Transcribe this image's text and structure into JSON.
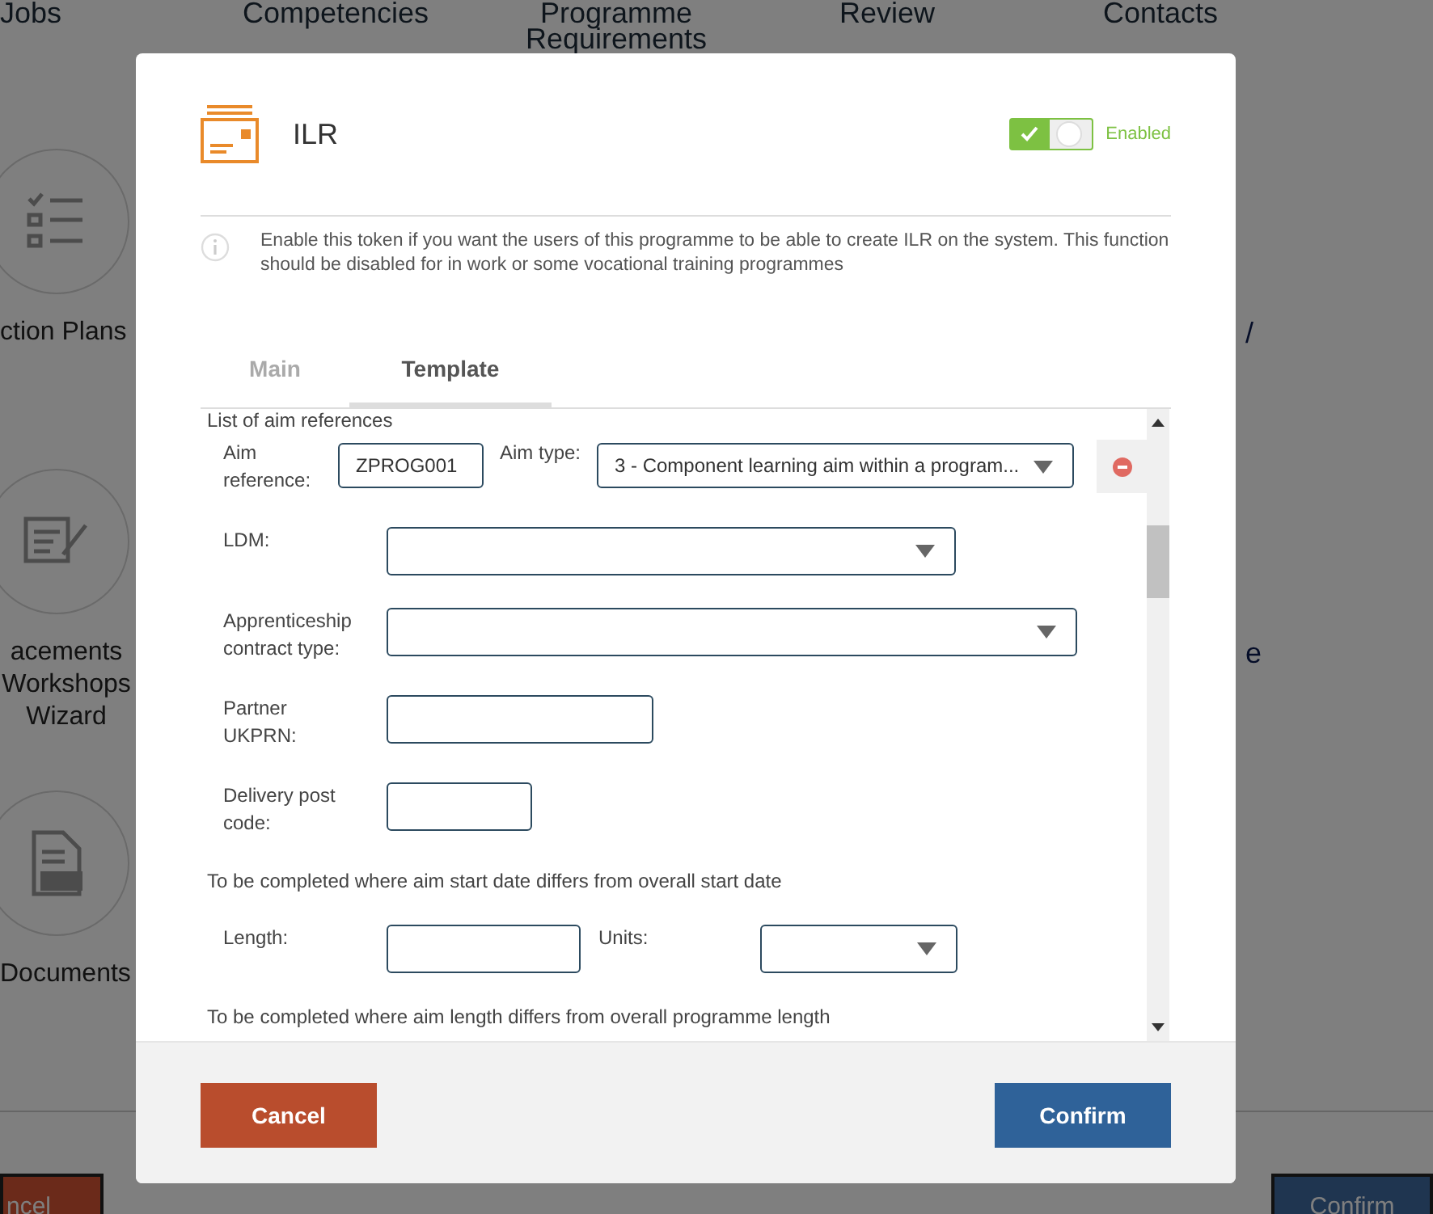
{
  "background": {
    "nav": [
      "Jobs",
      "Competencies",
      "Programme Requirements",
      "Review",
      "Contacts"
    ],
    "side_items": [
      {
        "label": "ction Plans",
        "kind": "list",
        "fragment": "/"
      },
      {
        "label": "acements Workshops Wizard",
        "kind": "edit",
        "fragment": "e"
      },
      {
        "label": "Documents",
        "kind": "pdf"
      }
    ],
    "buttons": [
      {
        "label": "ncel",
        "kind": "cancel"
      },
      {
        "label": "Confirm",
        "kind": "confirm"
      }
    ]
  },
  "dialog": {
    "title": "ILR",
    "toggle": {
      "on": true,
      "label": "Enabled"
    },
    "info": "Enable this token if you want the users of this programme to be able to create ILR on the system. This function should be disabled for in work or some vocational training programmes",
    "tabs": [
      {
        "label": "Main",
        "selected": false
      },
      {
        "label": "Template",
        "selected": true
      }
    ],
    "section_title": "List of aim references",
    "aim": {
      "reference_label": "Aim reference:",
      "reference_value": "ZPROG001",
      "type_label": "Aim type:",
      "type_value": "3 - Component learning aim within a program..."
    },
    "fields": [
      {
        "label": "LDM:",
        "kind": "select"
      },
      {
        "label": "Apprenticeship contract type:",
        "kind": "select"
      },
      {
        "label": "Partner UKPRN:",
        "kind": "text"
      },
      {
        "label": "Delivery post code:",
        "kind": "text"
      }
    ],
    "note_start": "To be completed where aim start date differs from overall start date",
    "length": {
      "label": "Length:",
      "kind": "text"
    },
    "units": {
      "label": "Units:",
      "kind": "select"
    },
    "note_length": "To be completed where aim length differs from overall programme length",
    "buttons": [
      {
        "label": "Cancel",
        "kind": "cancel"
      },
      {
        "label": "Confirm",
        "kind": "confirm"
      }
    ]
  }
}
